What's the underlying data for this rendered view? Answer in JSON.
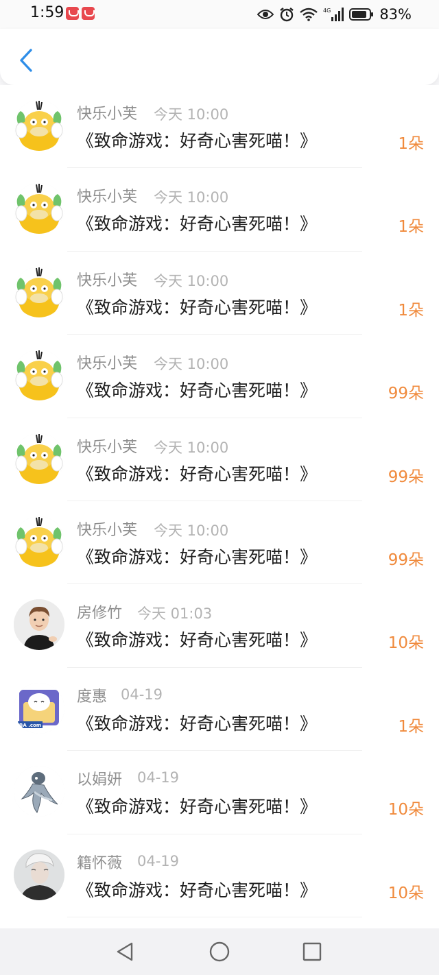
{
  "status_bar": {
    "time": "1:59",
    "battery_percent": "83%",
    "icons": [
      "app-notification-icon",
      "app-notification-icon",
      "eye-icon",
      "alarm-icon",
      "wifi-icon",
      "signal-4g-icon",
      "battery-icon"
    ]
  },
  "header": {
    "back_icon": "chevron-left-icon"
  },
  "colors": {
    "accent": "#2f8ee8",
    "amount": "#f08a3c",
    "name": "#8e8e8e",
    "time": "#b3b3b3"
  },
  "items": [
    {
      "name": "快乐小芙",
      "time": "今天 10:00",
      "title": "《致命游戏：好奇心害死喵！》",
      "amount": "1朵",
      "avatar": "duck"
    },
    {
      "name": "快乐小芙",
      "time": "今天 10:00",
      "title": "《致命游戏：好奇心害死喵！》",
      "amount": "1朵",
      "avatar": "duck"
    },
    {
      "name": "快乐小芙",
      "time": "今天 10:00",
      "title": "《致命游戏：好奇心害死喵！》",
      "amount": "1朵",
      "avatar": "duck"
    },
    {
      "name": "快乐小芙",
      "time": "今天 10:00",
      "title": "《致命游戏：好奇心害死喵！》",
      "amount": "99朵",
      "avatar": "duck"
    },
    {
      "name": "快乐小芙",
      "time": "今天 10:00",
      "title": "《致命游戏：好奇心害死喵！》",
      "amount": "99朵",
      "avatar": "duck"
    },
    {
      "name": "快乐小芙",
      "time": "今天 10:00",
      "title": "《致命游戏：好奇心害死喵！》",
      "amount": "99朵",
      "avatar": "duck"
    },
    {
      "name": "房修竹",
      "time": "今天 01:03",
      "title": "《致命游戏：好奇心害死喵！》",
      "amount": "10朵",
      "avatar": "boy"
    },
    {
      "name": "度惠",
      "time": "04-19",
      "title": "《致命游戏：好奇心害死喵！》",
      "amount": "1朵",
      "avatar": "cartoon"
    },
    {
      "name": "以娟妍",
      "time": "04-19",
      "title": "《致命游戏：好奇心害死喵！》",
      "amount": "10朵",
      "avatar": "ghost"
    },
    {
      "name": "籍怀薇",
      "time": "04-19",
      "title": "《致命游戏：好奇心害死喵！》",
      "amount": "10朵",
      "avatar": "portrait"
    }
  ],
  "nav_bar": {
    "icons": [
      "back-triangle-icon",
      "home-circle-icon",
      "recents-square-icon"
    ]
  }
}
